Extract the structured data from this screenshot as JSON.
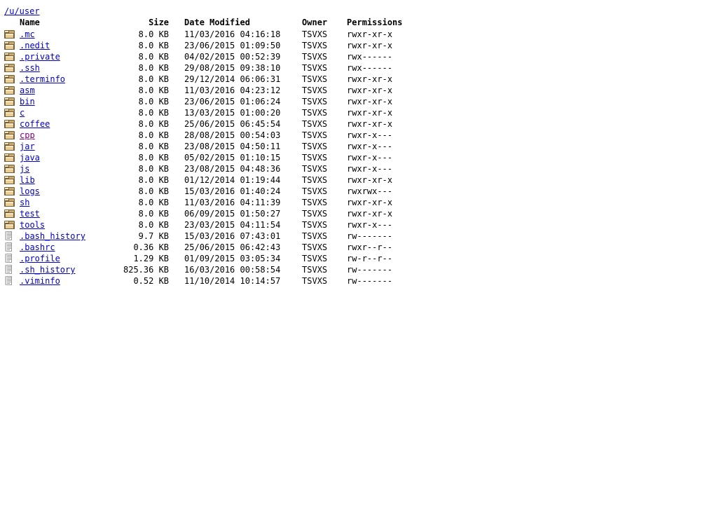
{
  "path": {
    "label": "/u/user"
  },
  "colors": {
    "link": "#0000cc",
    "visited_link": "#800080",
    "background": "#ffffff",
    "text": "#000000",
    "folder_icon": "#c8a96a",
    "file_icon": "#fdfdfd"
  },
  "columns": {
    "name": "Name",
    "size": "Size",
    "date_modified": "Date Modified",
    "owner": "Owner",
    "permissions": "Permissions"
  },
  "entries": [
    {
      "icon": "folder-icon",
      "type": "folder",
      "name": ".mc",
      "size": "8.0 KB",
      "date": "11/03/2016 04:16:18",
      "owner": "TSVXS",
      "permissions": "rwxr-xr-x",
      "visited": false
    },
    {
      "icon": "folder-icon",
      "type": "folder",
      "name": ".nedit",
      "size": "8.0 KB",
      "date": "23/06/2015 01:09:50",
      "owner": "TSVXS",
      "permissions": "rwxr-xr-x",
      "visited": false
    },
    {
      "icon": "folder-icon",
      "type": "folder",
      "name": ".private",
      "size": "8.0 KB",
      "date": "04/02/2015 00:52:39",
      "owner": "TSVXS",
      "permissions": "rwx------",
      "visited": false
    },
    {
      "icon": "folder-icon",
      "type": "folder",
      "name": ".ssh",
      "size": "8.0 KB",
      "date": "29/08/2015 09:38:10",
      "owner": "TSVXS",
      "permissions": "rwx------",
      "visited": false
    },
    {
      "icon": "folder-icon",
      "type": "folder",
      "name": ".terminfo",
      "size": "8.0 KB",
      "date": "29/12/2014 06:06:31",
      "owner": "TSVXS",
      "permissions": "rwxr-xr-x",
      "visited": false
    },
    {
      "icon": "folder-icon",
      "type": "folder",
      "name": "asm",
      "size": "8.0 KB",
      "date": "11/03/2016 04:23:12",
      "owner": "TSVXS",
      "permissions": "rwxr-xr-x",
      "visited": false
    },
    {
      "icon": "folder-icon",
      "type": "folder",
      "name": "bin",
      "size": "8.0 KB",
      "date": "23/06/2015 01:06:24",
      "owner": "TSVXS",
      "permissions": "rwxr-xr-x",
      "visited": false
    },
    {
      "icon": "folder-icon",
      "type": "folder",
      "name": "c",
      "size": "8.0 KB",
      "date": "13/03/2015 01:00:20",
      "owner": "TSVXS",
      "permissions": "rwxr-xr-x",
      "visited": false
    },
    {
      "icon": "folder-icon",
      "type": "folder",
      "name": "coffee",
      "size": "8.0 KB",
      "date": "25/06/2015 06:45:54",
      "owner": "TSVXS",
      "permissions": "rwxr-xr-x",
      "visited": false
    },
    {
      "icon": "folder-icon",
      "type": "folder",
      "name": "cpp",
      "size": "8.0 KB",
      "date": "28/08/2015 00:54:03",
      "owner": "TSVXS",
      "permissions": "rwxr-x---",
      "visited": true
    },
    {
      "icon": "folder-icon",
      "type": "folder",
      "name": "jar",
      "size": "8.0 KB",
      "date": "23/08/2015 04:50:11",
      "owner": "TSVXS",
      "permissions": "rwxr-x---",
      "visited": false
    },
    {
      "icon": "folder-icon",
      "type": "folder",
      "name": "java",
      "size": "8.0 KB",
      "date": "05/02/2015 01:10:15",
      "owner": "TSVXS",
      "permissions": "rwxr-x---",
      "visited": false
    },
    {
      "icon": "folder-icon",
      "type": "folder",
      "name": "js",
      "size": "8.0 KB",
      "date": "23/08/2015 04:48:36",
      "owner": "TSVXS",
      "permissions": "rwxr-x---",
      "visited": false
    },
    {
      "icon": "folder-icon",
      "type": "folder",
      "name": "lib",
      "size": "8.0 KB",
      "date": "01/12/2014 01:19:44",
      "owner": "TSVXS",
      "permissions": "rwxr-xr-x",
      "visited": false
    },
    {
      "icon": "folder-icon",
      "type": "folder",
      "name": "logs",
      "size": "8.0 KB",
      "date": "15/03/2016 01:40:24",
      "owner": "TSVXS",
      "permissions": "rwxrwx---",
      "visited": false
    },
    {
      "icon": "folder-icon",
      "type": "folder",
      "name": "sh",
      "size": "8.0 KB",
      "date": "11/03/2016 04:11:39",
      "owner": "TSVXS",
      "permissions": "rwxr-xr-x",
      "visited": false
    },
    {
      "icon": "folder-icon",
      "type": "folder",
      "name": "test",
      "size": "8.0 KB",
      "date": "06/09/2015 01:50:27",
      "owner": "TSVXS",
      "permissions": "rwxr-xr-x",
      "visited": false
    },
    {
      "icon": "folder-icon",
      "type": "folder",
      "name": "tools",
      "size": "8.0 KB",
      "date": "23/03/2015 04:11:54",
      "owner": "TSVXS",
      "permissions": "rwxr-x---",
      "visited": false
    },
    {
      "icon": "file-icon",
      "type": "file",
      "name": ".bash_history",
      "size": "9.7 KB",
      "date": "15/03/2016 07:43:01",
      "owner": "TSVXS",
      "permissions": "rw-------",
      "visited": false
    },
    {
      "icon": "file-icon",
      "type": "file",
      "name": ".bashrc",
      "size": "0.36 KB",
      "date": "25/06/2015 06:42:43",
      "owner": "TSVXS",
      "permissions": "rwxr--r--",
      "visited": false
    },
    {
      "icon": "file-icon",
      "type": "file",
      "name": ".profile",
      "size": "1.29 KB",
      "date": "01/09/2015 03:05:34",
      "owner": "TSVXS",
      "permissions": "rw-r--r--",
      "visited": false
    },
    {
      "icon": "file-icon",
      "type": "file",
      "name": ".sh_history",
      "size": "825.36 KB",
      "date": "16/03/2016 00:58:54",
      "owner": "TSVXS",
      "permissions": "rw-------",
      "visited": false
    },
    {
      "icon": "file-icon",
      "type": "file",
      "name": ".viminfo",
      "size": "0.52 KB",
      "date": "11/10/2014 10:14:57",
      "owner": "TSVXS",
      "permissions": "rw-------",
      "visited": false
    }
  ]
}
